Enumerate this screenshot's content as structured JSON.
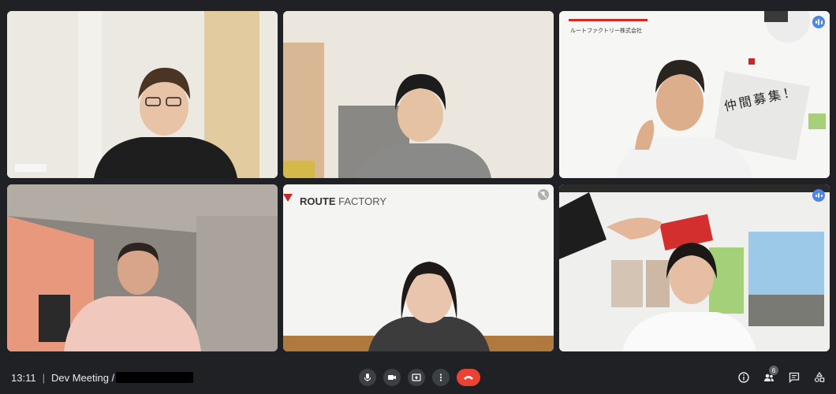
{
  "meeting": {
    "time": "13:11",
    "separator": "|",
    "title": "Dev Meeting /"
  },
  "tiles": {
    "t3": {
      "banner_text": "ルートファクトリー株式会社",
      "poster_text": "仲間募集！"
    },
    "t5": {
      "logo_bold": "ROUTE",
      "logo_light": "FACTORY"
    }
  },
  "toolbar": {
    "mic": "microphone-icon",
    "camera": "camera-icon",
    "present": "present-screen-icon",
    "more": "more-options-icon",
    "leave": "end-call-icon"
  },
  "side": {
    "info": "info-icon",
    "people": "people-icon",
    "people_count": "6",
    "chat": "chat-icon",
    "activities": "activities-icon"
  },
  "colors": {
    "accent": "#8ab4f8",
    "end_call": "#ea4335",
    "speaking": "#4e86e8"
  }
}
